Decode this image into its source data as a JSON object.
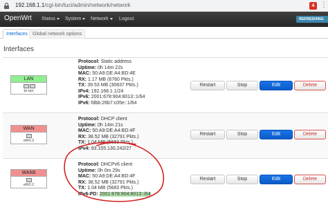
{
  "browser": {
    "url_host": "192.168.1.1",
    "url_path": "/cgi-bin/luci/admin/network/network",
    "ext_badge": "4"
  },
  "navbar": {
    "brand": "OpenWrt",
    "items": [
      "Status",
      "System",
      "Network",
      "Logout"
    ],
    "refresh_label": "REFRESHING"
  },
  "tabs": [
    "Interfaces",
    "Global network options"
  ],
  "section_title": "Interfaces",
  "actions": {
    "restart": "Restart",
    "stop": "Stop",
    "edit": "Edit",
    "delete": "Delete"
  },
  "interfaces": [
    {
      "name": "LAN",
      "device": "br-lan",
      "color": "#90f090",
      "lines": [
        {
          "k": "Protocol:",
          "v": "Static address"
        },
        {
          "k": "Uptime:",
          "v": "0h 14m 22s"
        },
        {
          "k": "MAC:",
          "v": "50:A9:DE:A4:BD:4E"
        },
        {
          "k": "RX:",
          "v": "1.17 MB (6760 Pkts.)"
        },
        {
          "k": "TX:",
          "v": "39.53 MB (30837 Pkts.)"
        },
        {
          "k": "IPv4:",
          "v": "192.168.1.1/24"
        },
        {
          "k": "IPv6:",
          "v": "2001:678:904:8013::1/64"
        },
        {
          "k": "IPv6:",
          "v": "fdbb:26b7:c05e::1/64"
        }
      ]
    },
    {
      "name": "WAN",
      "device": "eth0.2",
      "color": "#f09090",
      "lines": [
        {
          "k": "Protocol:",
          "v": "DHCP client"
        },
        {
          "k": "Uptime:",
          "v": "0h 14m 21s"
        },
        {
          "k": "MAC:",
          "v": "50:A9:DE:A4:BD:4F"
        },
        {
          "k": "RX:",
          "v": "38.52 MB (32791 Pkts.)"
        },
        {
          "k": "TX:",
          "v": "1.04 MB (5683 Pkts.)"
        },
        {
          "k": "IPv4:",
          "v": "93.155.130.242/27"
        }
      ]
    },
    {
      "name": "WAN6",
      "device": "eth0.2",
      "color": "#f09090",
      "lines": [
        {
          "k": "Protocol:",
          "v": "DHCPv6 client"
        },
        {
          "k": "Uptime:",
          "v": "0h 0m 29s"
        },
        {
          "k": "MAC:",
          "v": "50:A9:DE:A4:BD:4F"
        },
        {
          "k": "RX:",
          "v": "38.52 MB (32791 Pkts.)"
        },
        {
          "k": "TX:",
          "v": "1.04 MB (5683 Pkts.)"
        },
        {
          "k": "IPv6-PD:",
          "v": "2001:678:904:8013::/64"
        }
      ]
    }
  ],
  "annotation_color": "#d42020"
}
